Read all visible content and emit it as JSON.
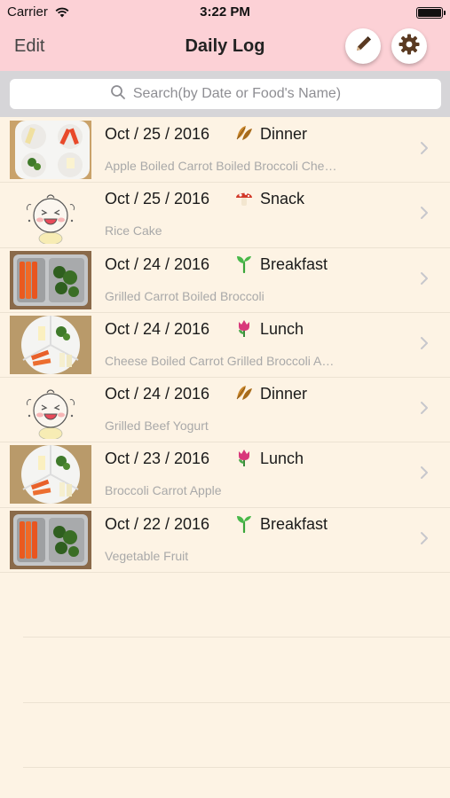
{
  "status": {
    "carrier": "Carrier",
    "time": "3:22 PM"
  },
  "nav": {
    "edit_label": "Edit",
    "title": "Daily Log",
    "pencil_icon": "pencil-icon",
    "settings_icon": "gear-icon"
  },
  "search": {
    "placeholder": "Search(by Date or Food's Name)"
  },
  "entries": [
    {
      "date": "Oct / 25 / 2016",
      "meal": "Dinner",
      "meal_icon": "leaf-pair-icon",
      "foods": "Apple  Boiled Carrot  Boiled Broccoli  Che…",
      "thumb": "plate-white"
    },
    {
      "date": "Oct / 25 / 2016",
      "meal": "Snack",
      "meal_icon": "mushroom-icon",
      "foods": "Rice Cake",
      "thumb": "baby"
    },
    {
      "date": "Oct / 24 / 2016",
      "meal": "Breakfast",
      "meal_icon": "sprout-icon",
      "foods": "Grilled Carrot  Boiled Broccoli",
      "thumb": "tray-steel"
    },
    {
      "date": "Oct / 24 / 2016",
      "meal": "Lunch",
      "meal_icon": "tulip-icon",
      "foods": "Cheese  Boiled Carrot  Grilled Broccoli  A…",
      "thumb": "plate-white2"
    },
    {
      "date": "Oct / 24 / 2016",
      "meal": "Dinner",
      "meal_icon": "leaf-pair-icon",
      "foods": "Grilled Beef  Yogurt",
      "thumb": "baby"
    },
    {
      "date": "Oct / 23 / 2016",
      "meal": "Lunch",
      "meal_icon": "tulip-icon",
      "foods": "Broccoli  Carrot  Apple",
      "thumb": "plate-white2"
    },
    {
      "date": "Oct / 22 / 2016",
      "meal": "Breakfast",
      "meal_icon": "sprout-icon",
      "foods": "Vegetable  Fruit",
      "thumb": "tray-steel"
    }
  ],
  "colors": {
    "navbar": "#fcd1d6",
    "background": "#fdf3e4",
    "search_bar": "#d6d5d8",
    "secondary_text": "#a9a9a9"
  }
}
